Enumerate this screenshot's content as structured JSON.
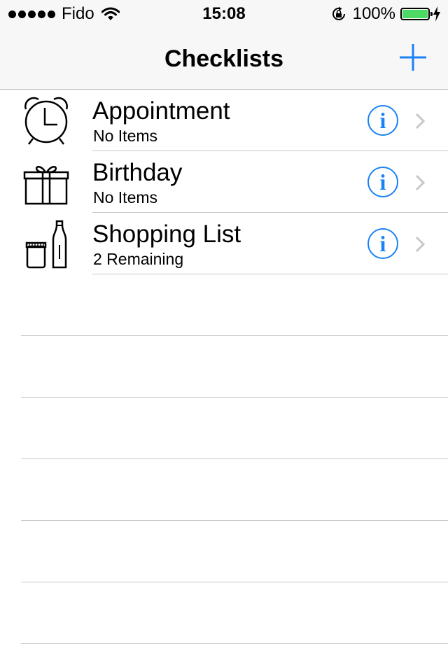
{
  "status_bar": {
    "carrier": "Fido",
    "time": "15:08",
    "battery_percent": "100%",
    "battery_level": 1.0,
    "battery_color": "#4cd964"
  },
  "nav_bar": {
    "title": "Checklists",
    "add_icon": "plus-icon",
    "accent_color": "#1a82f7"
  },
  "checklists": [
    {
      "icon": "alarm-clock-icon",
      "title": "Appointment",
      "subtitle": "No Items"
    },
    {
      "icon": "gift-icon",
      "title": "Birthday",
      "subtitle": "No Items"
    },
    {
      "icon": "groceries-icon",
      "title": "Shopping List",
      "subtitle": "2 Remaining"
    }
  ],
  "row_accessories": {
    "info_glyph": "i",
    "detail_icon": "chevron-right-icon"
  }
}
